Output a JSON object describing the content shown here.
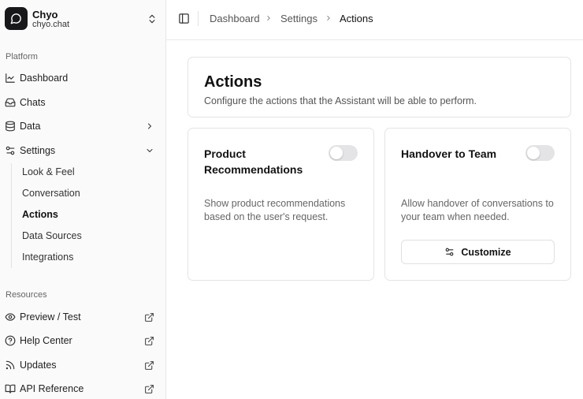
{
  "org": {
    "name": "Chyo",
    "domain": "chyo.chat"
  },
  "sidebar": {
    "platform_label": "Platform",
    "resources_label": "Resources",
    "platform_items": [
      {
        "label": "Dashboard",
        "icon": "line-chart-icon"
      },
      {
        "label": "Chats",
        "icon": "inbox-icon"
      },
      {
        "label": "Data",
        "icon": "database-icon"
      },
      {
        "label": "Settings",
        "icon": "settings-sliders-icon"
      }
    ],
    "settings_sub": [
      {
        "label": "Look & Feel"
      },
      {
        "label": "Conversation"
      },
      {
        "label": "Actions",
        "active": true
      },
      {
        "label": "Data Sources"
      },
      {
        "label": "Integrations"
      }
    ],
    "resource_items": [
      {
        "label": "Preview / Test",
        "icon": "eye-icon"
      },
      {
        "label": "Help Center",
        "icon": "help-circle-icon"
      },
      {
        "label": "Updates",
        "icon": "rss-icon"
      },
      {
        "label": "API Reference",
        "icon": "book-icon"
      }
    ]
  },
  "breadcrumb": [
    "Dashboard",
    "Settings",
    "Actions"
  ],
  "page": {
    "title": "Actions",
    "description": "Configure the actions that the Assistant will be able to perform."
  },
  "actions": [
    {
      "title": "Product Recommendations",
      "description": "Show product recommendations based on the user's request.",
      "enabled": false
    },
    {
      "title": "Handover to Team",
      "description": "Allow handover of conversations to your team when needed.",
      "enabled": false,
      "button_label": "Customize"
    }
  ],
  "colors": {
    "accent": "#18181b",
    "switch_off": "#e4e4e7",
    "sidebar_bg": "#fafafa"
  }
}
